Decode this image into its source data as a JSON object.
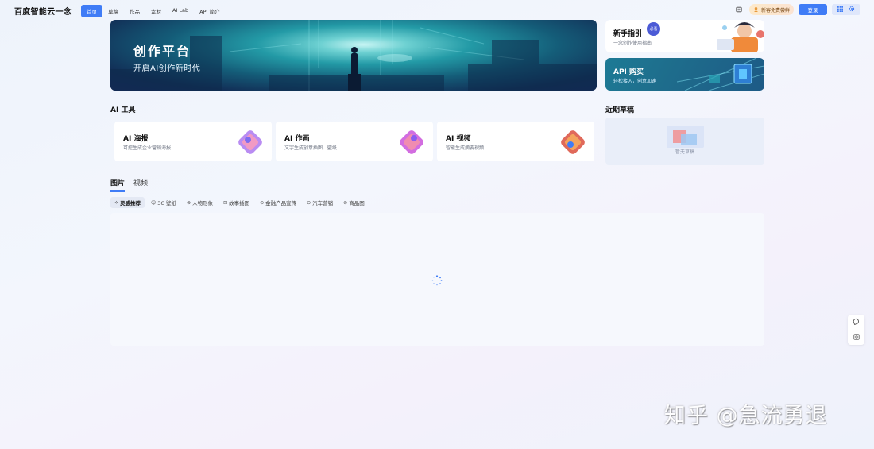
{
  "header": {
    "logo": "百度智能云一念",
    "nav": [
      {
        "label": "首页",
        "active": true
      },
      {
        "label": "草稿",
        "active": false
      },
      {
        "label": "作品",
        "active": false
      },
      {
        "label": "素材",
        "active": false
      },
      {
        "label": "AI Lab",
        "active": false
      },
      {
        "label": "API 简介",
        "active": false
      }
    ],
    "promo_label": "新客免费尝鲜",
    "login_label": "登录"
  },
  "banner": {
    "title": "创作平台",
    "subtitle": "开启AI创作新时代"
  },
  "guide_card": {
    "title": "新手指引",
    "subtitle": "一念创作使用指南",
    "badge": "必看"
  },
  "api_card": {
    "title": "API 购买",
    "subtitle": "轻松接入，创意加速"
  },
  "ai_tools": {
    "heading": "AI 工具",
    "items": [
      {
        "title": "AI 海报",
        "subtitle": "可控生成企业营销海报"
      },
      {
        "title": "AI 作画",
        "subtitle": "文字生成创意插图、壁纸"
      },
      {
        "title": "AI 视频",
        "subtitle": "智能生成摘要视频"
      }
    ]
  },
  "drafts": {
    "heading": "近期草稿",
    "empty_text": "暂无草稿"
  },
  "gallery": {
    "tabs": [
      {
        "label": "图片",
        "active": true
      },
      {
        "label": "视频",
        "active": false
      }
    ],
    "filters": [
      {
        "label": "灵感推荐",
        "active": true,
        "icon": "sparkle-icon"
      },
      {
        "label": "3C 壁纸",
        "active": false,
        "icon": "smile-icon"
      },
      {
        "label": "人物形象",
        "active": false,
        "icon": "person-icon"
      },
      {
        "label": "故事插图",
        "active": false,
        "icon": "image-icon"
      },
      {
        "label": "金融产品宣传",
        "active": false,
        "icon": "coin-icon"
      },
      {
        "label": "汽车营销",
        "active": false,
        "icon": "car-icon"
      },
      {
        "label": "商品图",
        "active": false,
        "icon": "bag-icon"
      }
    ]
  },
  "watermark": "知乎 @急流勇退",
  "colors": {
    "accent": "#3f7cf6",
    "text": "#1d2129",
    "muted": "#6b7280"
  }
}
